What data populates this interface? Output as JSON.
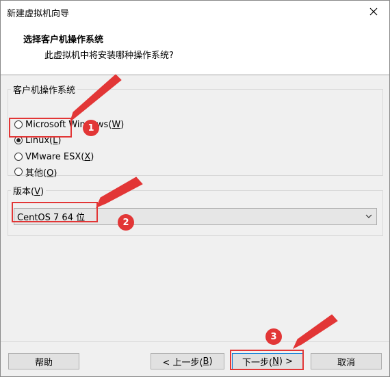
{
  "window": {
    "title": "新建虚拟机向导"
  },
  "header": {
    "title": "选择客户机操作系统",
    "subtitle": "此虚拟机中将安装哪种操作系统?"
  },
  "os_group": {
    "label": "客户机操作系统",
    "options": [
      {
        "text": "Microsoft Windows(",
        "mnemonic": "W",
        "suffix": ")",
        "checked": false
      },
      {
        "text": "Linux(",
        "mnemonic": "L",
        "suffix": ")",
        "checked": true
      },
      {
        "text": "VMware ESX(",
        "mnemonic": "X",
        "suffix": ")",
        "checked": false
      },
      {
        "text": "其他(",
        "mnemonic": "O",
        "suffix": ")",
        "checked": false
      }
    ]
  },
  "version_group": {
    "label_prefix": "版本(",
    "label_mnemonic": "V",
    "label_suffix": ")",
    "selected": "CentOS 7 64 位"
  },
  "buttons": {
    "help": "帮助",
    "back_prefix": "< 上一步(",
    "back_mnemonic": "B",
    "back_suffix": ")",
    "next_prefix": "下一步(",
    "next_mnemonic": "N",
    "next_suffix": ") >",
    "cancel": "取消"
  },
  "annotations": {
    "badges": [
      "1",
      "2",
      "3"
    ],
    "color": "#e23636"
  }
}
